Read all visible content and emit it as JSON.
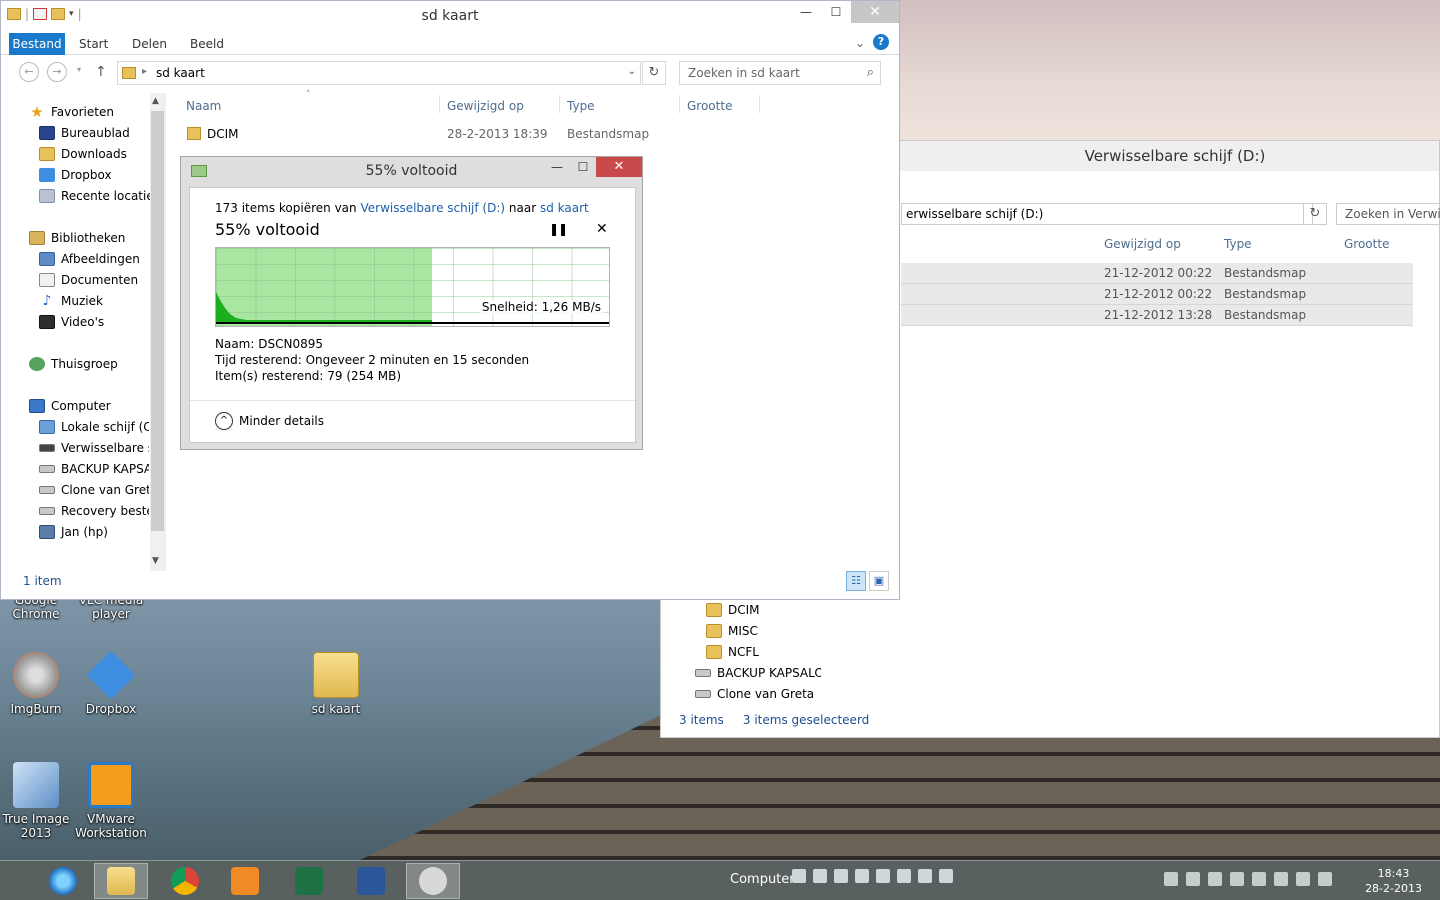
{
  "window": {
    "title": "sd kaart",
    "ribbon_tabs": [
      "Bestand",
      "Start",
      "Delen",
      "Beeld"
    ],
    "address_path": "sd kaart",
    "search_placeholder": "Zoeken in sd kaart",
    "columns": [
      "Naam",
      "Gewijzigd op",
      "Type",
      "Grootte"
    ],
    "files": [
      {
        "name": "DCIM",
        "modified": "28-2-2013 18:39",
        "type": "Bestandsmap",
        "size": ""
      }
    ],
    "status_count": "1 item",
    "nav": {
      "favorites_header": "Favorieten",
      "favorites": [
        "Bureaublad",
        "Downloads",
        "Dropbox",
        "Recente locaties"
      ],
      "libraries_header": "Bibliotheken",
      "libraries": [
        "Afbeeldingen",
        "Documenten",
        "Muziek",
        "Video's"
      ],
      "homegroup": "Thuisgroep",
      "computer_header": "Computer",
      "drives": [
        "Lokale schijf (C:)",
        "Verwisselbare schijf",
        "BACKUP KAPSALON",
        "Clone van Greta",
        "Recovery bestemming",
        "Jan (hp)"
      ]
    }
  },
  "progress_dialog": {
    "title": "55% voltooid",
    "summary_prefix": "173 items kopiëren van",
    "source": "Verwisselbare schijf (D:)",
    "summary_mid": "naar",
    "destination": "sd kaart",
    "percent_text": "55% voltooid",
    "progress": 0.55,
    "speed_text": "Snelheid: 1,26 MB/s",
    "name_text": "Naam:  DSCN0895",
    "time_text": "Tijd resterend:  Ongeveer 2 minuten en 15 seconden",
    "items_text": "Item(s) resterend:  79 (254 MB)",
    "less_details": "Minder details"
  },
  "back_window": {
    "title": "Verwisselbare schijf (D:)",
    "address_path": "erwisselbare schijf (D:)",
    "search_placeholder": "Zoeken in Verwisselbare schijf (D:)",
    "columns": [
      "Gewijzigd op",
      "Type",
      "Grootte"
    ],
    "rows": [
      {
        "modified": "21-12-2012 00:22",
        "type": "Bestandsmap"
      },
      {
        "modified": "21-12-2012 00:22",
        "type": "Bestandsmap"
      },
      {
        "modified": "21-12-2012 13:28",
        "type": "Bestandsmap"
      }
    ],
    "tree": [
      "DCIM",
      "MISC",
      "NCFL",
      "BACKUP KAPSALON",
      "Clone van Greta"
    ],
    "status_count": "3 items",
    "status_selected": "3 items geselecteerd"
  },
  "desktop_icons": [
    {
      "label": "Google\nChrome"
    },
    {
      "label": "VLC media\nplayer"
    },
    {
      "label": "ImgBurn"
    },
    {
      "label": "Dropbox"
    },
    {
      "label": "sd kaart"
    },
    {
      "label": "True Image\n2013"
    },
    {
      "label": "VMware\nWorkstation"
    }
  ],
  "taskbar": {
    "toolbar_label": "Computer",
    "time": "18:43",
    "date": "28-2-2013"
  }
}
